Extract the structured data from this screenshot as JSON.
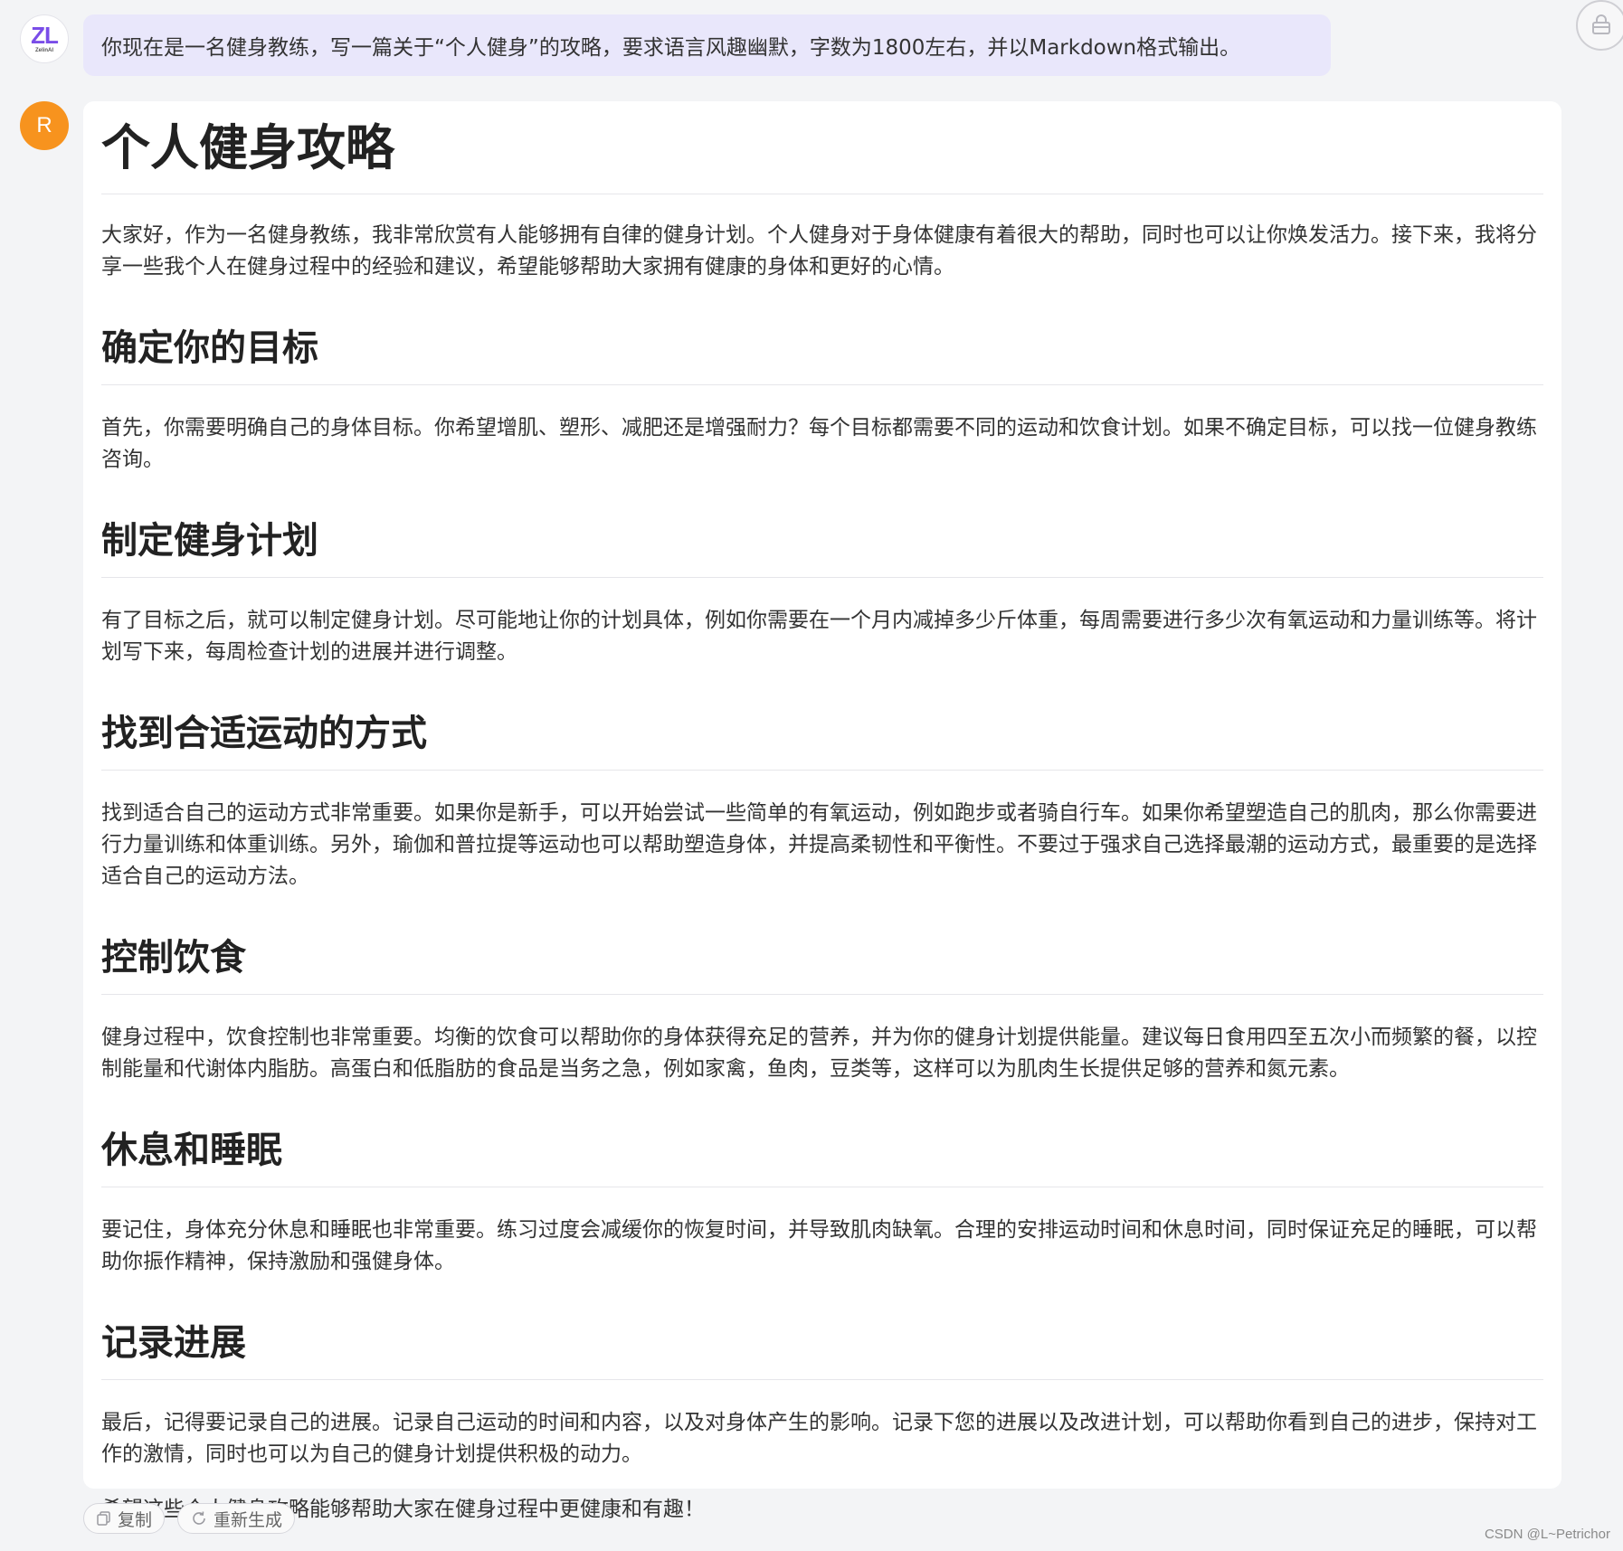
{
  "prompt": {
    "avatar_logo": "ZL",
    "avatar_logo_sub": "ZelinAI",
    "text": "你现在是一名健身教练，写一篇关于“个人健身”的攻略，要求语言风趣幽默，字数为1800左右，并以Markdown格式输出。"
  },
  "corner_button": {
    "icon": "bag-icon"
  },
  "response": {
    "avatar_letter": "R",
    "title": "个人健身攻略",
    "intro": "大家好，作为一名健身教练，我非常欣赏有人能够拥有自律的健身计划。个人健身对于身体健康有着很大的帮助，同时也可以让你焕发活力。接下来，我将分享一些我个人在健身过程中的经验和建议，希望能够帮助大家拥有健康的身体和更好的心情。",
    "sections": [
      {
        "heading": "确定你的目标",
        "body": "首先，你需要明确自己的身体目标。你希望增肌、塑形、减肥还是增强耐力？每个目标都需要不同的运动和饮食计划。如果不确定目标，可以找一位健身教练咨询。"
      },
      {
        "heading": "制定健身计划",
        "body": "有了目标之后，就可以制定健身计划。尽可能地让你的计划具体，例如你需要在一个月内减掉多少斤体重，每周需要进行多少次有氧运动和力量训练等。将计划写下来，每周检查计划的进展并进行调整。"
      },
      {
        "heading": "找到合适运动的方式",
        "body": "找到适合自己的运动方式非常重要。如果你是新手，可以开始尝试一些简单的有氧运动，例如跑步或者骑自行车。如果你希望塑造自己的肌肉，那么你需要进行力量训练和体重训练。另外，瑜伽和普拉提等运动也可以帮助塑造身体，并提高柔韧性和平衡性。不要过于强求自己选择最潮的运动方式，最重要的是选择适合自己的运动方法。"
      },
      {
        "heading": "控制饮食",
        "body": "健身过程中，饮食控制也非常重要。均衡的饮食可以帮助你的身体获得充足的营养，并为你的健身计划提供能量。建议每日食用四至五次小而频繁的餐，以控制能量和代谢体内脂肪。高蛋白和低脂肪的食品是当务之急，例如家禽，鱼肉，豆类等，这样可以为肌肉生长提供足够的营养和氮元素。"
      },
      {
        "heading": "休息和睡眠",
        "body": "要记住，身体充分休息和睡眠也非常重要。练习过度会减缓你的恢复时间，并导致肌肉缺氧。合理的安排运动时间和休息时间，同时保证充足的睡眠，可以帮助你振作精神，保持激励和强健身体。"
      },
      {
        "heading": "记录进展",
        "body": "最后，记得要记录自己的进展。记录自己运动的时间和内容，以及对身体产生的影响。记录下您的进展以及改进计划，可以帮助你看到自己的进步，保持对工作的激情，同时也可以为自己的健身计划提供积极的动力。"
      }
    ],
    "closing": "希望这些个人健身攻略能够帮助大家在健身过程中更健康和有趣！"
  },
  "actions": {
    "copy_label": "复制",
    "copy_icon": "copy-icon",
    "regenerate_label": "重新生成",
    "regenerate_icon": "refresh-icon"
  },
  "watermark": "CSDN @L~Petrichor",
  "colors": {
    "page_bg": "#f3f4f6",
    "prompt_bubble": "#e9e7fb",
    "avatar_orange": "#f7931e",
    "logo_purple": "#7a4de8"
  }
}
